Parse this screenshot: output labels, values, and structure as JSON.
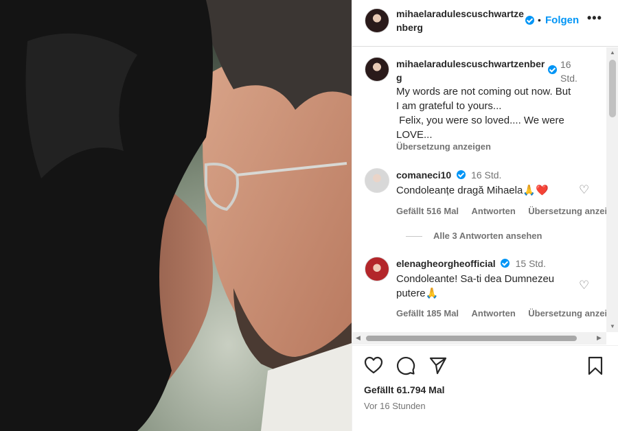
{
  "header": {
    "username": "mihaelaradulescuschwartzenberg",
    "dot": "•",
    "follow_label": "Folgen",
    "more_label": "•••"
  },
  "caption": {
    "username": "mihaelaradulescuschwartzenberg",
    "time": "16 Std.",
    "text_lines": [
      "My words are not coming out now. But",
      "I am grateful to yours...",
      " Felix, you were so loved.... We were",
      "LOVE..."
    ],
    "translate_label": "Übersetzung anzeigen"
  },
  "comments": [
    {
      "username": "comaneci10",
      "time": "16 Std.",
      "text": "Condoleanțe dragă Mihaela🙏❤️",
      "likes_label": "Gefällt 516 Mal",
      "reply_label": "Antworten",
      "translate_label": "Übersetzung anzei"
    },
    {
      "username": "elenagheorgheofficial",
      "time": "15 Std.",
      "text_lines": [
        "Condoleante! Sa-ti dea Dumnezeu",
        "putere🙏"
      ],
      "likes_label": "Gefällt 185 Mal",
      "reply_label": "Antworten",
      "translate_label": "Übersetzung anzei"
    }
  ],
  "replies_label": "Alle 3 Antworten ansehen",
  "footer": {
    "likes": "Gefällt 61.794 Mal",
    "posted": "Vor 16 Stunden"
  },
  "colors": {
    "accent": "#0095f6",
    "muted": "#737373",
    "text": "#262626"
  },
  "icons": [
    "heart-icon",
    "comment-icon",
    "share-icon",
    "bookmark-icon",
    "verified-icon"
  ]
}
